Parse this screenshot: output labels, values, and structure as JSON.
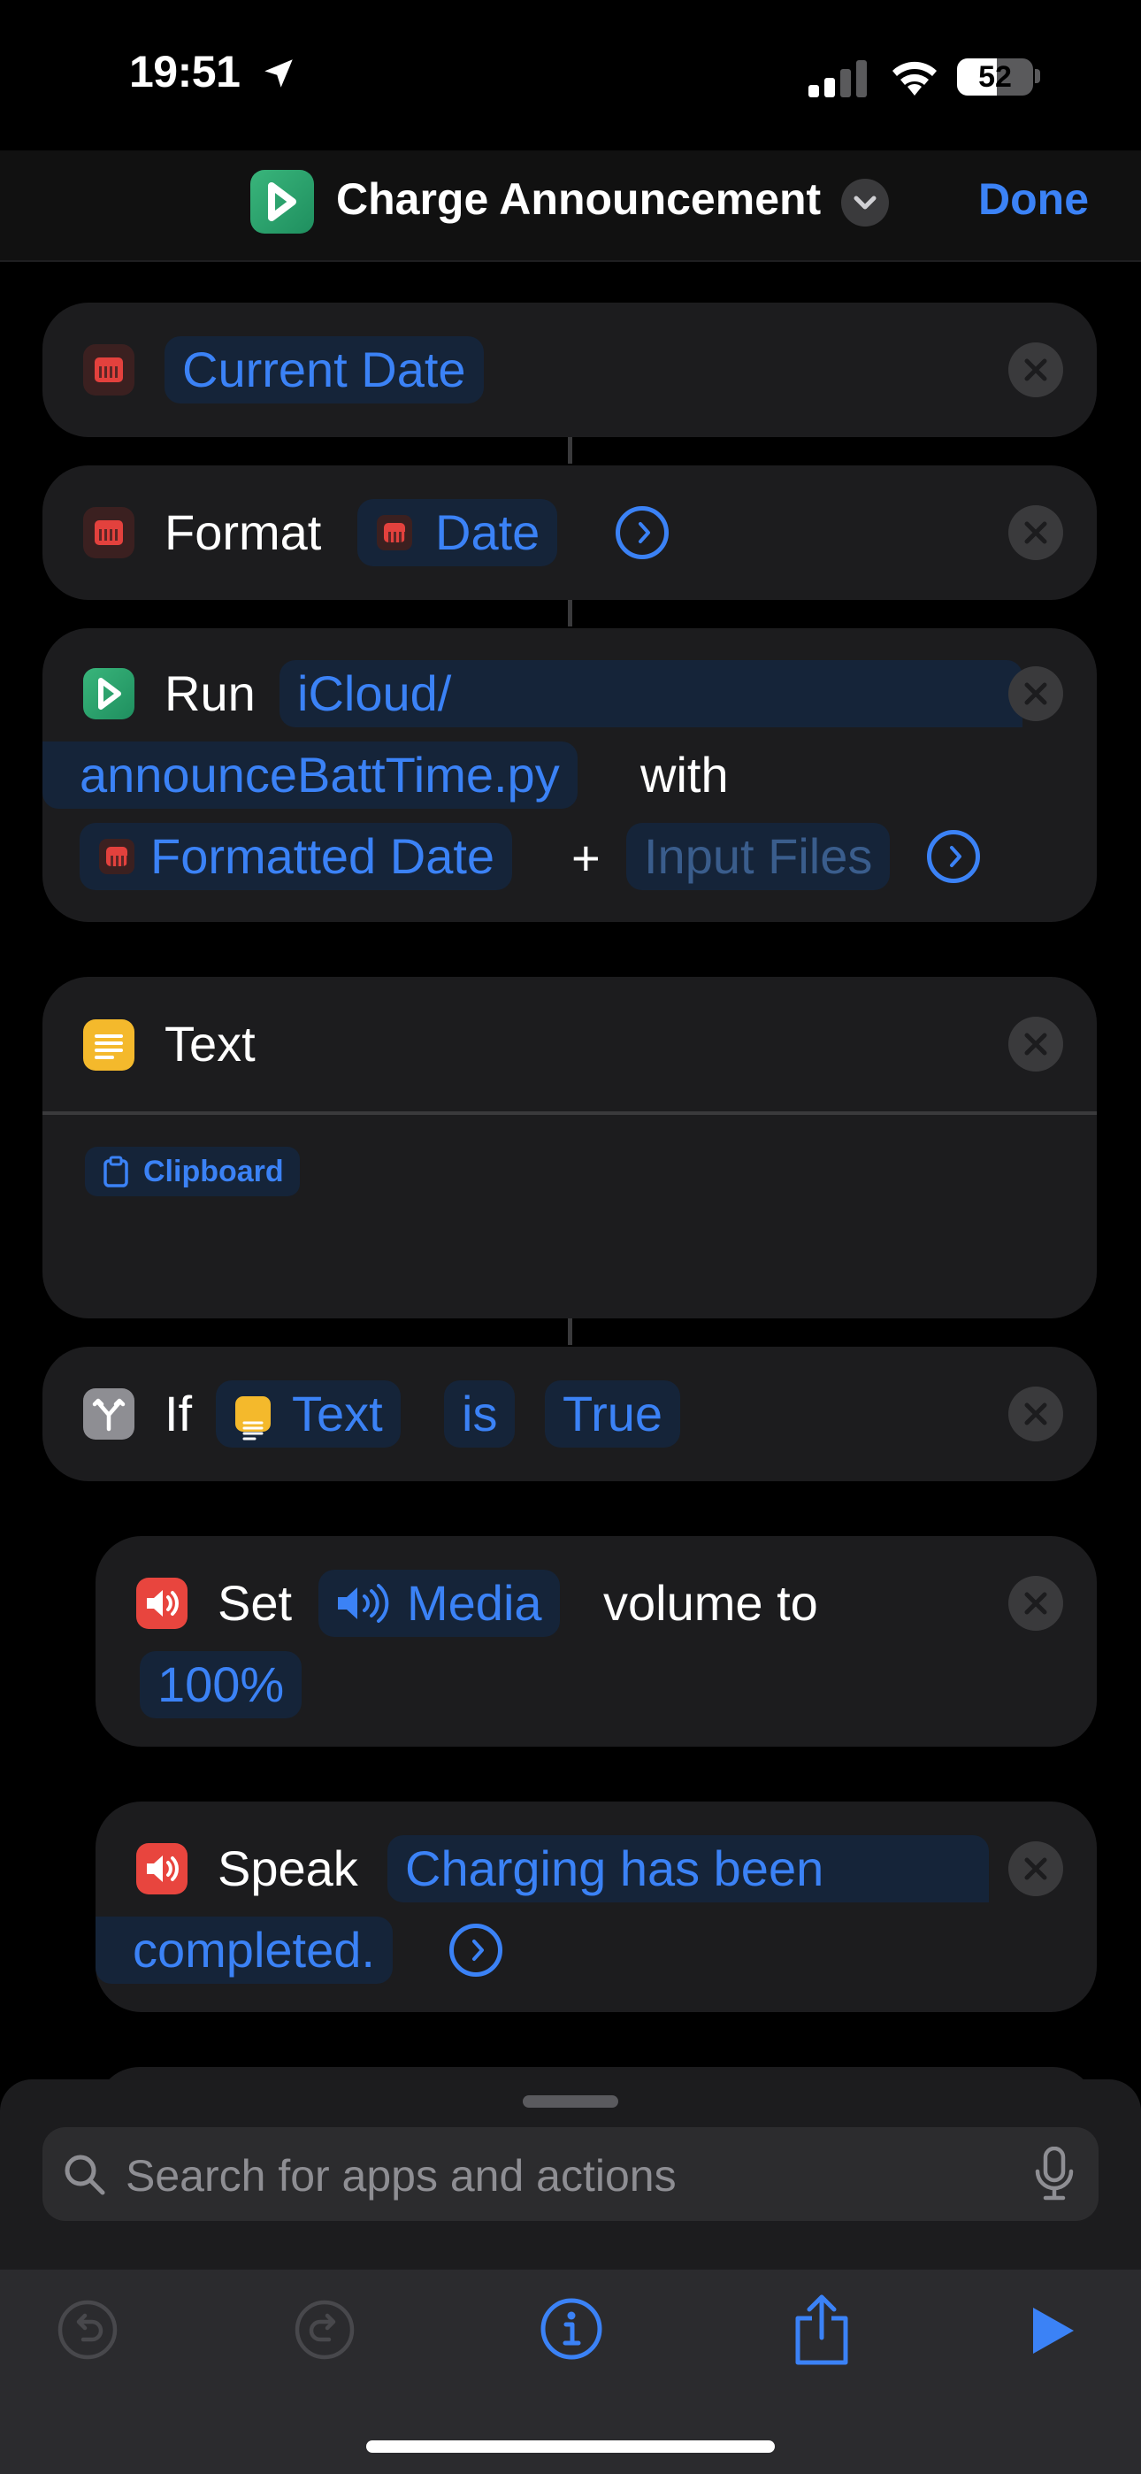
{
  "status": {
    "time": "19:51",
    "battery": "52",
    "battery_level": 0.52
  },
  "nav": {
    "title": "Charge Announcement",
    "done": "Done"
  },
  "actions": {
    "current_date": {
      "token": "Current Date"
    },
    "format": {
      "label": "Format",
      "token": "Date"
    },
    "run": {
      "label": "Run",
      "script_line1": "iCloud/",
      "script_line2": "announceBattTime.py",
      "with": "with",
      "input_token": "Formatted Date",
      "plus": "+",
      "files_token": "Input Files"
    },
    "text": {
      "label": "Text",
      "clipboard": "Clipboard"
    },
    "if": {
      "label": "If",
      "var": "Text",
      "op": "is",
      "value": "True"
    },
    "set_volume": {
      "label": "Set",
      "media": "Media",
      "suffix": "volume to",
      "value": "100%"
    },
    "speak": {
      "label": "Speak",
      "line1": "Charging has been",
      "line2": "completed."
    }
  },
  "search": {
    "placeholder": "Search for apps and actions"
  },
  "colors": {
    "accent": "#3b82f6",
    "card": "#1c1c1e",
    "token_bg": "#152439"
  }
}
